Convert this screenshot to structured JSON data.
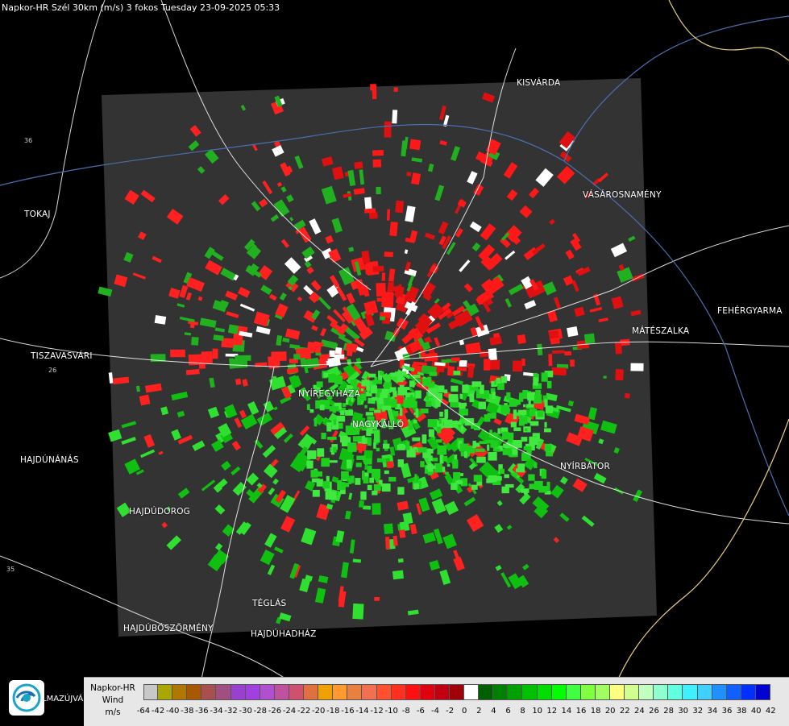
{
  "header": {
    "title": "Napkor-HR Szél 30km (m/s) 3 fokos Tuesday 23-09-2025 05:33"
  },
  "cities": [
    {
      "name": "KISVÁRDA"
    },
    {
      "name": "TOKAJ"
    },
    {
      "name": "VÁSÁROSNAMÉNY"
    },
    {
      "name": "FEHÉRGYARMA"
    },
    {
      "name": "MÁTÉSZALKA"
    },
    {
      "name": "TISZAVASVÁRI"
    },
    {
      "name": "NYÍREGYHÁZA"
    },
    {
      "name": "NAGYKÁLLÓ"
    },
    {
      "name": "HAJDÚNÁNÁS"
    },
    {
      "name": "NYÍRBÁTOR"
    },
    {
      "name": "HAJDÚDOROG"
    },
    {
      "name": "TÉGLÁS"
    },
    {
      "name": "HAJDÚBÖSZÖRMÉNY"
    },
    {
      "name": "HAJDÚHADHÁZ"
    }
  ],
  "roads": [
    "36",
    "26",
    "35"
  ],
  "legend": {
    "title_lines": [
      "Napkor-HR",
      "Wind",
      "m/s"
    ],
    "colors": [
      "#c8c8c8",
      "#a8a800",
      "#b07800",
      "#a85800",
      "#a85050",
      "#a05080",
      "#9a40d0",
      "#a040e0",
      "#b050d0",
      "#c050a0",
      "#d05070",
      "#e07040",
      "#f0a000",
      "#ff9a30",
      "#e88040",
      "#f07050",
      "#ff5030",
      "#ff3020",
      "#ff1010",
      "#e00010",
      "#c00010",
      "#a00008",
      "#ffffff",
      "#006000",
      "#008000",
      "#00a000",
      "#00c000",
      "#00dd00",
      "#00ff00",
      "#40ff40",
      "#80ff40",
      "#a0ff60",
      "#ffff80",
      "#d0ff90",
      "#c0ffc0",
      "#90ffd0",
      "#60ffe0",
      "#40f0ff",
      "#40d0ff",
      "#2090ff",
      "#1060ff",
      "#0030ff",
      "#0000d0"
    ],
    "tick_labels": [
      "-64",
      "-42",
      "-40",
      "-38",
      "-36",
      "-34",
      "-32",
      "-30",
      "-28",
      "-26",
      "-24",
      "-22",
      "-20",
      "-18",
      "-16",
      "-14",
      "-12",
      "-10",
      "-8",
      "-6",
      "-4",
      "-2",
      "0",
      "2",
      "4",
      "6",
      "8",
      "10",
      "12",
      "14",
      "16",
      "18",
      "20",
      "22",
      "24",
      "26",
      "28",
      "30",
      "32",
      "34",
      "36",
      "38",
      "40",
      "42"
    ]
  },
  "brand": {
    "text": "LMAZÚJVÁR"
  }
}
